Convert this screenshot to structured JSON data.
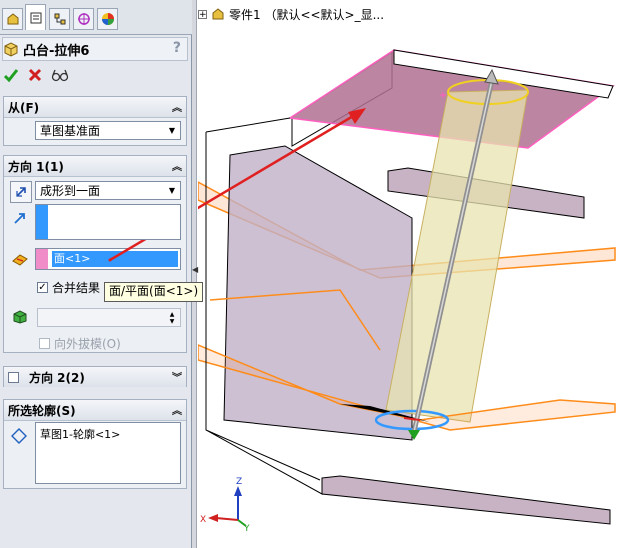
{
  "feature": {
    "title": "凸台-拉伸6",
    "help": "?"
  },
  "from": {
    "header": "从(F)",
    "value": "草图基准面"
  },
  "direction1": {
    "header": "方向 1(1)",
    "end_condition": "成形到一面",
    "face_selection": "面<1>",
    "merge_result_label": "合并结果",
    "draft_outward_label": "向外拔模(O)",
    "tooltip": "面/平面(面<1>)"
  },
  "direction2": {
    "header": "方向 2(2)"
  },
  "contours": {
    "header": "所选轮廓(S)",
    "items": [
      "草图1-轮廓<1>"
    ]
  },
  "tree": {
    "label": "零件1 （默认<<默认>_显..."
  },
  "triad": {
    "x": "X",
    "y": "Y",
    "z": "Z"
  },
  "colors": {
    "accent": "#3399ff",
    "face_pink": "#f08cc8",
    "arrow_red": "#e02020",
    "plane_orange": "#ff8c1a"
  }
}
